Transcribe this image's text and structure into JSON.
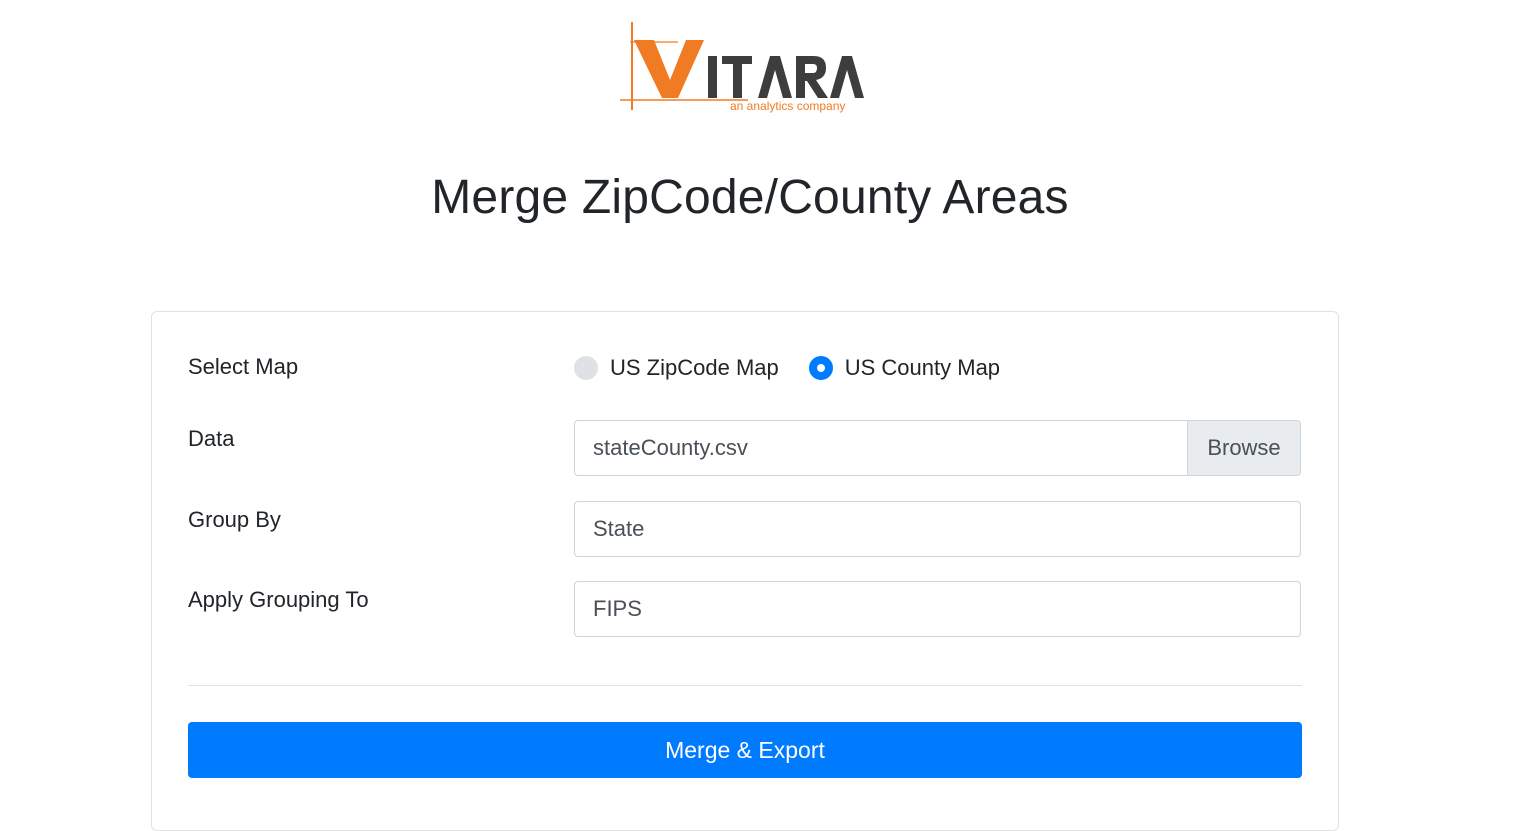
{
  "logo": {
    "brand": "VITARA",
    "tagline": "an analytics company",
    "colors": {
      "orange": "#f07b22",
      "dark": "#3d3d3d"
    }
  },
  "page": {
    "title": "Merge ZipCode/County Areas"
  },
  "form": {
    "select_map": {
      "label": "Select Map",
      "options": [
        {
          "label": "US ZipCode Map",
          "checked": false
        },
        {
          "label": "US County Map",
          "checked": true
        }
      ]
    },
    "data": {
      "label": "Data",
      "value": "stateCounty.csv",
      "browse_label": "Browse"
    },
    "group_by": {
      "label": "Group By",
      "value": "State"
    },
    "apply_grouping_to": {
      "label": "Apply Grouping To",
      "value": "FIPS"
    },
    "submit_label": "Merge & Export"
  },
  "colors": {
    "primary": "#007bff",
    "border": "#ced4da",
    "text": "#212529"
  }
}
